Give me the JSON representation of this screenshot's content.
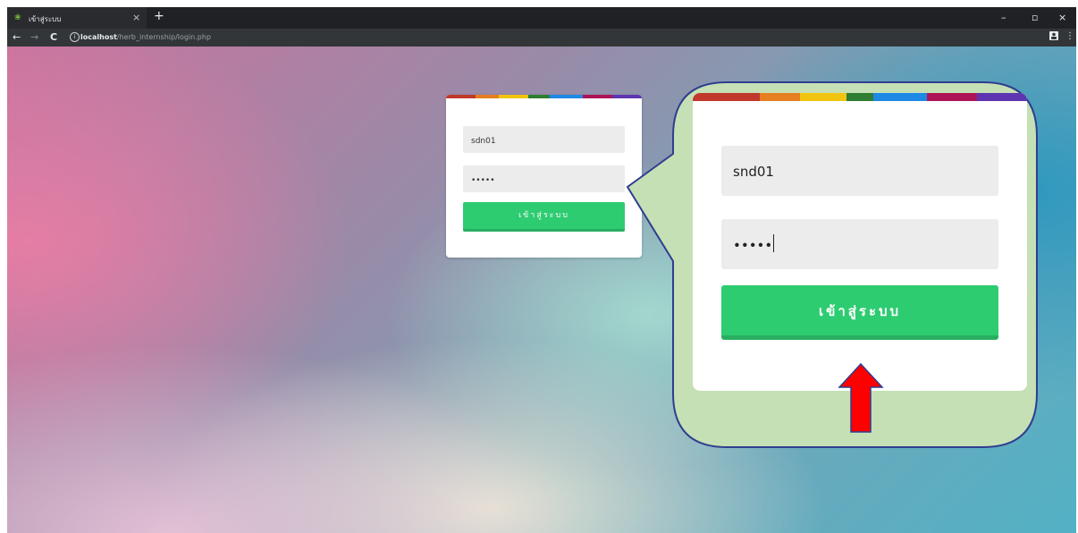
{
  "browser": {
    "tab_title": "เข้าสู่ระบบ",
    "tab_close": "×",
    "new_tab": "+",
    "url_host": "localhost",
    "url_path": "/herb_internship/login.php",
    "back": "←",
    "forward": "→",
    "reload": "C",
    "window_minimize": "–",
    "window_maximize": "▫",
    "window_close": "×"
  },
  "login_small": {
    "username_value": "sdn01",
    "password_value": "•••••",
    "submit_label": "เข้าสู่ระบบ"
  },
  "login_zoom": {
    "username_value": "snd01",
    "password_value": "•••••",
    "submit_label": "เข้าสู่ระบบ"
  },
  "colors": {
    "bar": [
      "#c0392b",
      "#e67e22",
      "#f1c40f",
      "#2e7d32",
      "#1e88e5",
      "#ad1457",
      "#5e35b1"
    ],
    "button_green": "#2ecc71",
    "callout_fill": "#c5e0b4",
    "callout_border": "#2f3e8f",
    "arrow_fill": "#ff0000"
  }
}
